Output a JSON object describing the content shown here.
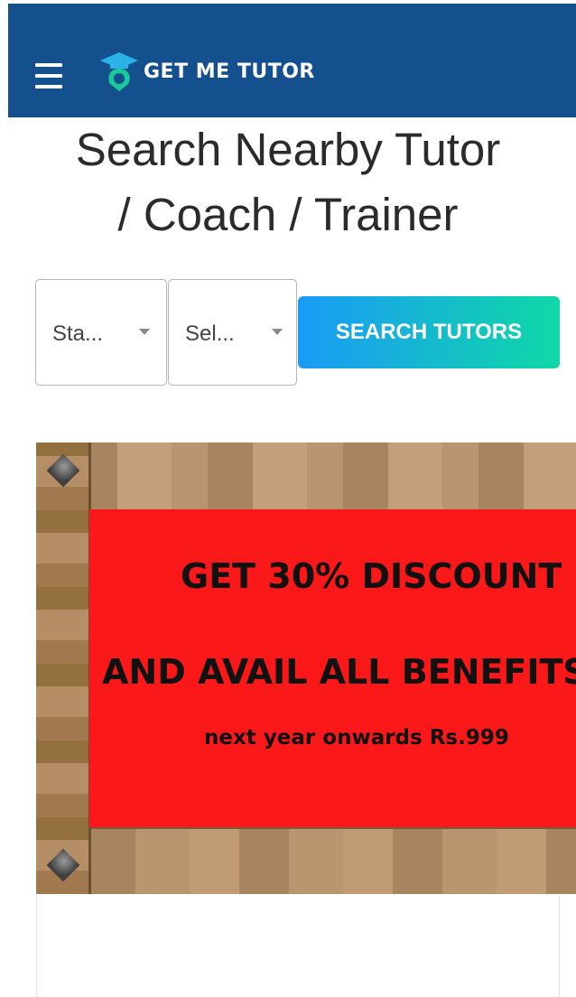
{
  "header": {
    "menu_icon": "hamburger-menu-icon",
    "logo_icon": "graduation-cap-pin-icon",
    "logo_text": "GET ME TUTOR",
    "background_color": "#14508e"
  },
  "page": {
    "title_line1": "Search Nearby Tutor",
    "title_line2": "/ Coach / Trainer"
  },
  "search": {
    "state_select_value": "Sta...",
    "subject_select_value": "Sel...",
    "button_label": "SEARCH TUTORS",
    "button_gradient": [
      "#1a9af7",
      "#0fd8a6"
    ]
  },
  "banner": {
    "line1": "GET 30% DISCOUNT",
    "line2": "AND AVAIL ALL BENEFITS",
    "line3": "next year onwards Rs.999",
    "panel_color": "#fb1818"
  }
}
